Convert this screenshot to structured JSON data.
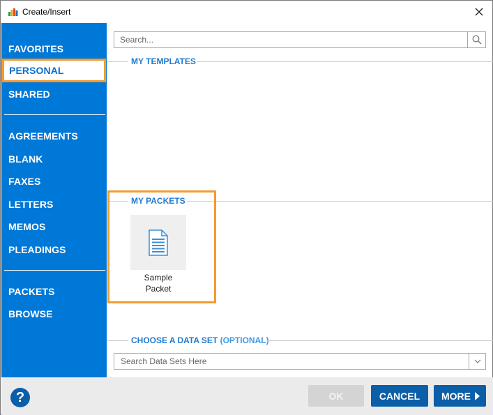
{
  "window": {
    "title": "Create/Insert",
    "close_symbol": "✕"
  },
  "sidebar": {
    "groups": [
      {
        "items": [
          {
            "label": "FAVORITES"
          },
          {
            "label": "PERSONAL",
            "selected": true
          },
          {
            "label": "SHARED"
          }
        ]
      },
      {
        "items": [
          {
            "label": "AGREEMENTS"
          },
          {
            "label": "BLANK"
          },
          {
            "label": "FAXES"
          },
          {
            "label": "LETTERS"
          },
          {
            "label": "MEMOS"
          },
          {
            "label": "PLEADINGS"
          }
        ]
      },
      {
        "items": [
          {
            "label": "PACKETS"
          },
          {
            "label": "BROWSE"
          }
        ]
      }
    ]
  },
  "search": {
    "placeholder": "Search...",
    "icon": "search-icon"
  },
  "sections": {
    "templates": {
      "title": "MY TEMPLATES"
    },
    "packets": {
      "title": "MY PACKETS",
      "items": [
        {
          "label_line1": "Sample",
          "label_line2": "Packet",
          "icon": "document-icon"
        }
      ]
    },
    "dataset": {
      "title": "CHOOSE A DATA SET",
      "title_optional": "(OPTIONAL)",
      "placeholder": "Search Data Sets Here"
    }
  },
  "footer": {
    "help_label": "?",
    "ok_label": "OK",
    "cancel_label": "CANCEL",
    "more_label": "MORE"
  },
  "colors": {
    "sidebar_bg": "#0078d7",
    "accent_blue": "#0b5ea8",
    "highlight_orange": "#f59a2f",
    "section_title": "#1f7ad1",
    "disabled_button": "#d4d4d4",
    "footer_bg": "#ebebeb"
  }
}
